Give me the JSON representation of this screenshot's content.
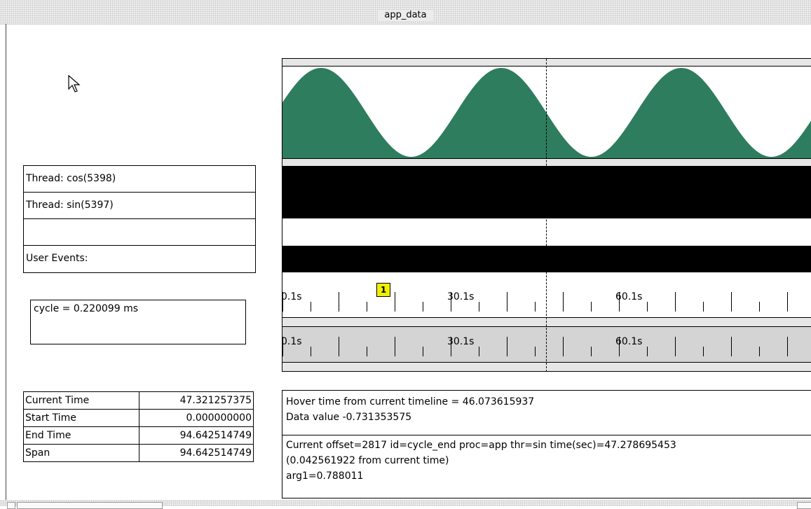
{
  "window": {
    "title": "app_data"
  },
  "threads": [
    {
      "label": "Thread: cos(5398)"
    },
    {
      "label": "Thread: sin(5397)"
    },
    {
      "label": ""
    },
    {
      "label": "User Events:"
    }
  ],
  "cycle": {
    "text": "cycle = 0.220099 ms"
  },
  "stats": {
    "rows": [
      {
        "label": "Current Time",
        "value": "47.321257375"
      },
      {
        "label": "Start Time",
        "value": "0.000000000"
      },
      {
        "label": "End Time",
        "value": "94.642514749"
      },
      {
        "label": "Span",
        "value": "94.642514749"
      }
    ]
  },
  "timeline": {
    "labels": [
      "0.1s",
      "30.1s",
      "60.1s"
    ],
    "marker": "1"
  },
  "info": {
    "hover_time": "Hover time from current timeline = 46.073615937",
    "data_value": "Data value -0.731353575",
    "event_line1": "Current offset=2817  id=cycle_end  proc=app  thr=sin  time(sec)=47.278695453",
    "event_line2": "(0.042561922 from current time)",
    "event_line3": "arg1=0.788011"
  },
  "colors": {
    "waveform": "#2e7d5e",
    "marker": "#f0f000"
  },
  "icons": {
    "pointer": "mouse-pointer-icon"
  }
}
